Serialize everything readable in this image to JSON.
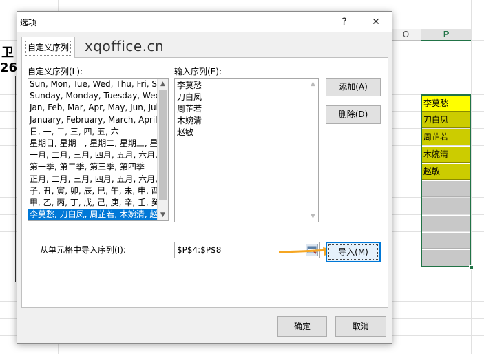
{
  "spreadsheet": {
    "column_headers": [
      "O",
      "P"
    ],
    "selected_column": "P",
    "p_cells": [
      "李莫愁",
      "刀白凤",
      "周芷若",
      "木婉清",
      "赵敏",
      "",
      "",
      "",
      "",
      ""
    ],
    "left_fragments": [
      "卫",
      "26"
    ]
  },
  "dialog": {
    "title": "选项",
    "help_button": "?",
    "close_button": "✕",
    "tab_label": "自定义序列",
    "watermark": "xqoffice.cn",
    "custom_lists_label": "自定义序列(L):",
    "custom_lists": [
      "Sun, Mon, Tue, Wed, Thu, Fri, Sat",
      "Sunday, Monday, Tuesday, Wednesday",
      "Jan, Feb, Mar, Apr, May, Jun, Jul",
      "January, February, March, April, May",
      "日, 一, 二, 三, 四, 五, 六",
      "星期日, 星期一, 星期二, 星期三, 星期四",
      "一月, 二月, 三月, 四月, 五月, 六月, 七月",
      "第一季, 第二季, 第三季, 第四季",
      "正月, 二月, 三月, 四月, 五月, 六月, 七月",
      "子, 丑, 寅, 卯, 辰, 巳, 午, 未, 申, 酉, 戌",
      "甲, 乙, 丙, 丁, 戊, 己, 庚, 辛, 壬, 癸",
      "李莫愁, 刀白凤, 周芷若, 木婉清, 赵敏"
    ],
    "selected_list_index": 11,
    "entries_label": "输入序列(E):",
    "entries": [
      "李莫愁",
      "刀白凤",
      "周芷若",
      "木婉清",
      "赵敏"
    ],
    "add_button": "添加(A)",
    "delete_button": "删除(D)",
    "import_label": "从单元格中导入序列(I):",
    "import_range": "$P$4:$P$8",
    "import_button": "导入(M)",
    "ok_button": "确定",
    "cancel_button": "取消"
  }
}
